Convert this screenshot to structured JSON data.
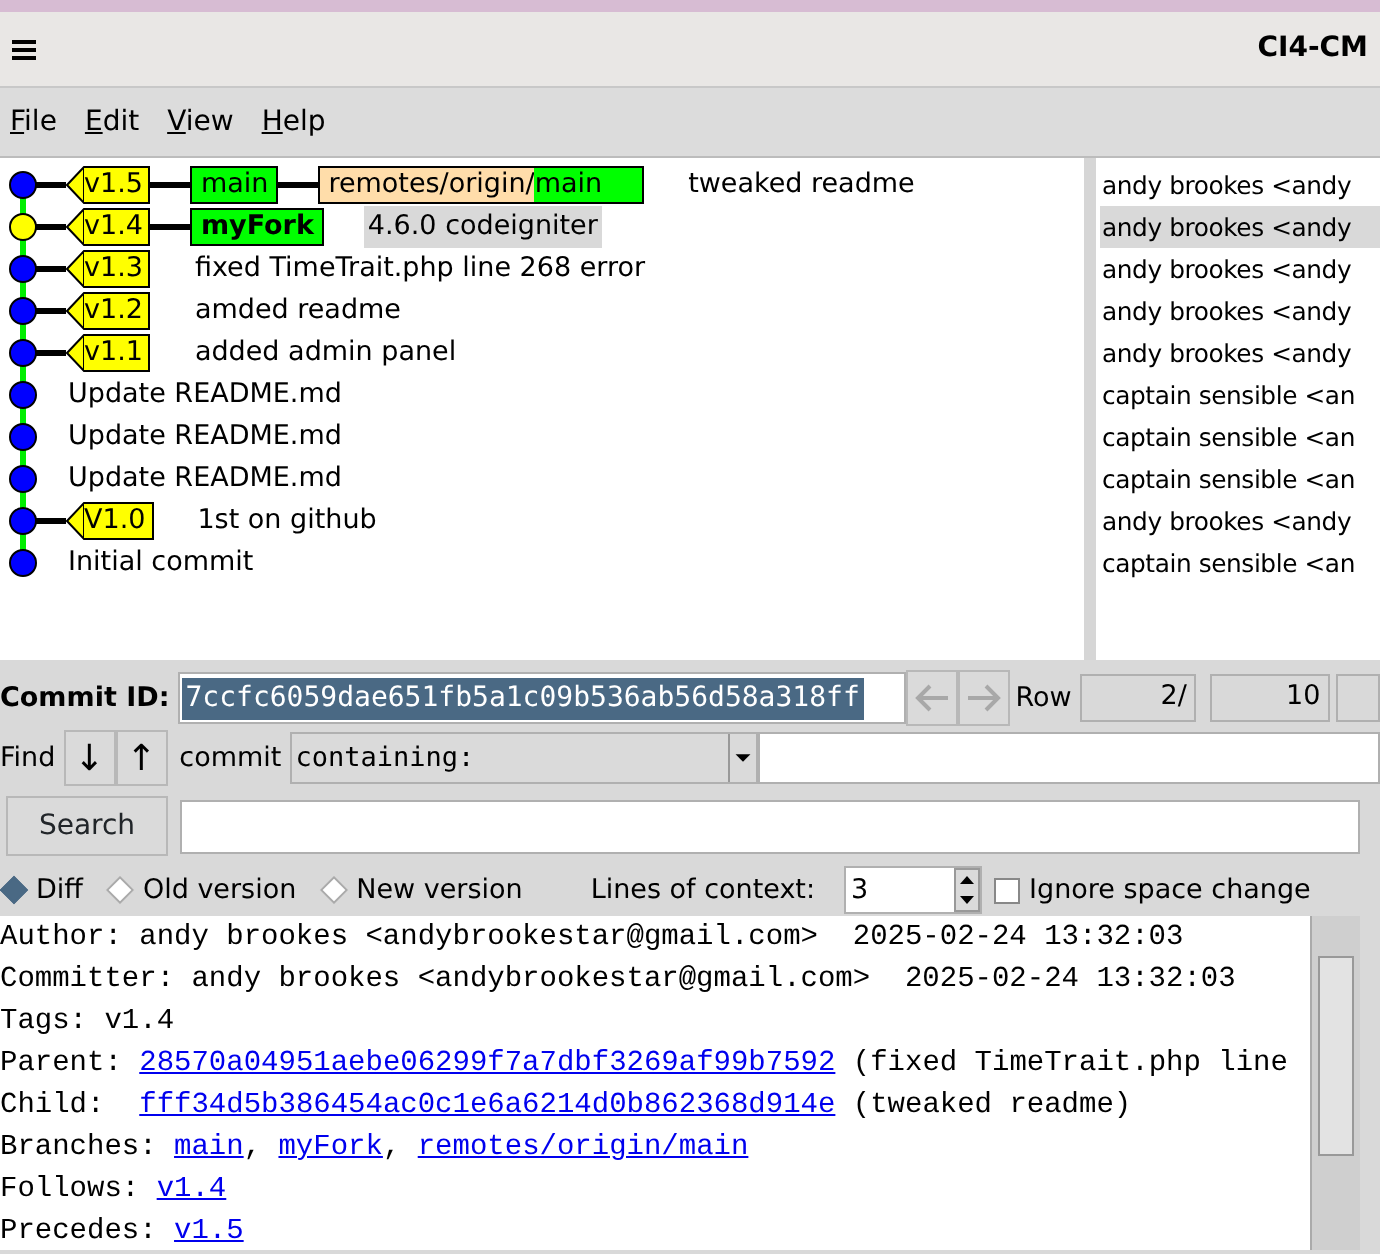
{
  "window": {
    "title": "CI4-CM"
  },
  "menu": [
    "File",
    "Edit",
    "View",
    "Help"
  ],
  "commits": [
    {
      "color": "#0000ff",
      "tags": [
        "v1.5"
      ],
      "branches": [
        {
          "kind": "local",
          "name": "main",
          "current": false
        },
        {
          "kind": "remote",
          "prefix": "remotes/origin/",
          "name": "main",
          "current": false
        }
      ],
      "message": "tweaked readme",
      "author": "andy brookes <andy",
      "selected": false
    },
    {
      "color": "#ffff00",
      "tags": [
        "v1.4"
      ],
      "branches": [
        {
          "kind": "local",
          "name": "myFork",
          "current": true
        }
      ],
      "message": "4.6.0 codeigniter",
      "author": "andy brookes <andy",
      "selected": true
    },
    {
      "color": "#0000ff",
      "tags": [
        "v1.3"
      ],
      "message": "fixed TimeTrait.php line 268 error",
      "author": "andy brookes <andy",
      "selected": false
    },
    {
      "color": "#0000ff",
      "tags": [
        "v1.2"
      ],
      "message": "amded readme",
      "author": "andy brookes <andy",
      "selected": false
    },
    {
      "color": "#0000ff",
      "tags": [
        "v1.1"
      ],
      "message": "added admin panel",
      "author": "andy brookes <andy",
      "selected": false
    },
    {
      "color": "#0000ff",
      "message": "Update README.md",
      "author": "captain sensible <an",
      "selected": false
    },
    {
      "color": "#0000ff",
      "message": "Update README.md",
      "author": "captain sensible <an",
      "selected": false
    },
    {
      "color": "#0000ff",
      "message": "Update README.md",
      "author": "captain sensible <an",
      "selected": false
    },
    {
      "color": "#0000ff",
      "tags": [
        "V1.0"
      ],
      "message": "1st on github",
      "author": "andy brookes <andy",
      "selected": false
    },
    {
      "color": "#0000ff",
      "message": "Initial commit",
      "author": "captain sensible <an",
      "selected": false
    }
  ],
  "commit_id": {
    "label": "Commit ID:",
    "value": "7ccfc6059dae651fb5a1c09b536ab56d58a318ff",
    "back_disabled": true,
    "forward_disabled": true
  },
  "row": {
    "label": "Row",
    "current": "2/",
    "total": "10"
  },
  "find": {
    "label": "Find",
    "down": "↓",
    "up": "↑",
    "type": "commit",
    "mode": "containing:"
  },
  "search": {
    "button": "Search"
  },
  "view_options": [
    {
      "label": "Diff",
      "selected": true
    },
    {
      "label": "Old version",
      "selected": false
    },
    {
      "label": "New version",
      "selected": false
    }
  ],
  "context": {
    "label": "Lines of context:",
    "value": "3"
  },
  "ignore_space": {
    "label": "Ignore space change",
    "checked": false
  },
  "details": [
    [
      {
        "kind": "text",
        "text": "Author: andy brookes <andybrookestar@gmail.com>  2025-02-24 13:32:03"
      }
    ],
    [
      {
        "kind": "text",
        "text": "Committer: andy brookes <andybrookestar@gmail.com>  2025-02-24 13:32:03"
      }
    ],
    [
      {
        "kind": "text",
        "text": "Tags: v1.4"
      }
    ],
    [
      {
        "kind": "text",
        "text": "Parent: "
      },
      {
        "kind": "link",
        "text": "28570a04951aebe06299f7a7dbf3269af99b7592"
      },
      {
        "kind": "text",
        "text": " (fixed TimeTrait.php line"
      }
    ],
    [
      {
        "kind": "text",
        "text": "Child:  "
      },
      {
        "kind": "link",
        "text": "fff34d5b386454ac0c1e6a6214d0b862368d914e"
      },
      {
        "kind": "text",
        "text": " (tweaked readme)"
      }
    ],
    [
      {
        "kind": "text",
        "text": "Branches: "
      },
      {
        "kind": "link",
        "text": "main"
      },
      {
        "kind": "text",
        "text": ", "
      },
      {
        "kind": "link",
        "text": "myFork"
      },
      {
        "kind": "text",
        "text": ", "
      },
      {
        "kind": "link",
        "text": "remotes/origin/main"
      }
    ],
    [
      {
        "kind": "text",
        "text": "Follows: "
      },
      {
        "kind": "link",
        "text": "v1.4"
      }
    ],
    [
      {
        "kind": "text",
        "text": "Precedes: "
      },
      {
        "kind": "link",
        "text": "v1.5"
      }
    ]
  ]
}
